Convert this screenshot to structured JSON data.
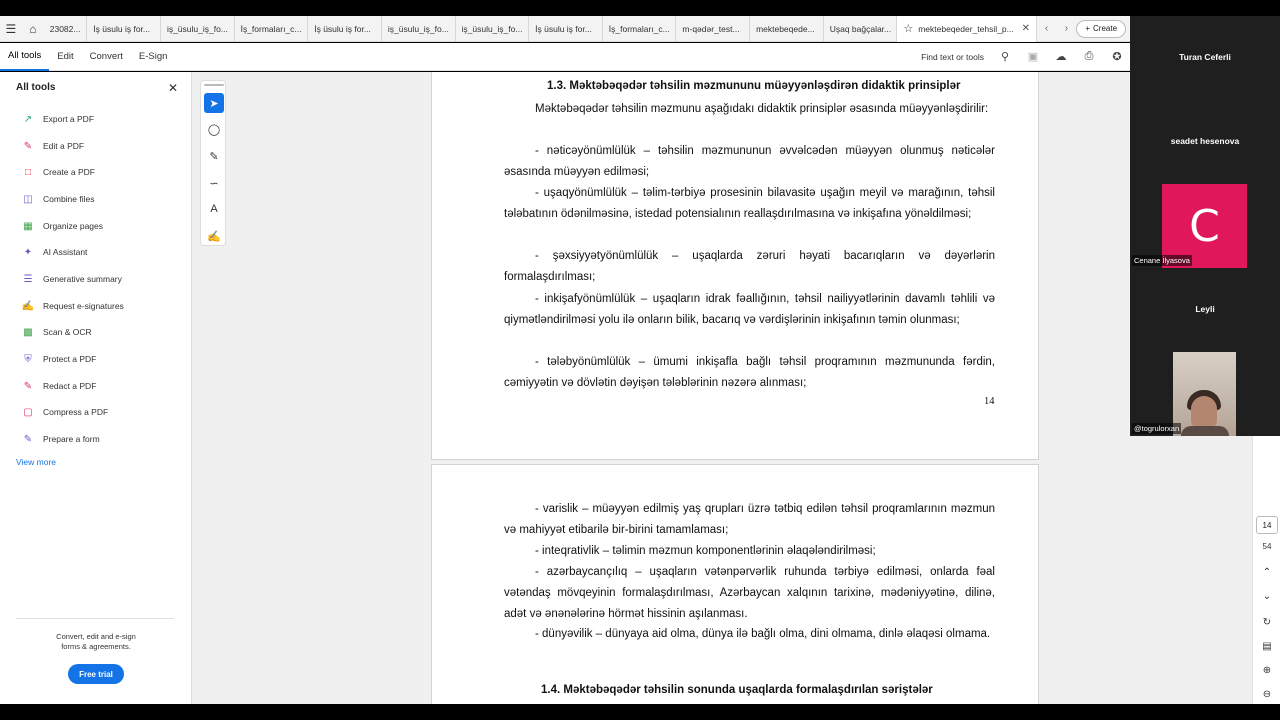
{
  "browser": {
    "tabs": [
      {
        "label": "23082..."
      },
      {
        "label": "İş üsulu iş for..."
      },
      {
        "label": "iş_üsulu_iş_fo..."
      },
      {
        "label": "İş_formaları_c..."
      },
      {
        "label": "İş üsulu iş for..."
      },
      {
        "label": "iş_üsulu_iş_fo..."
      },
      {
        "label": "iş_üsulu_iş_fo..."
      },
      {
        "label": "İş üsulu iş for..."
      },
      {
        "label": "İş_formaları_c..."
      },
      {
        "label": "m-qədər_test..."
      },
      {
        "label": "mektebeqede..."
      },
      {
        "label": "Uşaq bağçalar..."
      }
    ],
    "active_tab": {
      "label": "mektebeqeder_tehsil_p..."
    },
    "create_label": "Create"
  },
  "toolbar": {
    "menus": [
      "All tools",
      "Edit",
      "Convert",
      "E-Sign"
    ],
    "find_text": "Find text or tools"
  },
  "left_panel": {
    "title": "All tools",
    "items": [
      {
        "label": "Export a PDF",
        "icon": "export-pdf-icon",
        "color": "#26a269"
      },
      {
        "label": "Edit a PDF",
        "icon": "edit-pdf-icon",
        "color": "#d8345f"
      },
      {
        "label": "Create a PDF",
        "icon": "create-pdf-icon",
        "color": "#e0344a"
      },
      {
        "label": "Combine files",
        "icon": "combine-files-icon",
        "color": "#6f5ac7"
      },
      {
        "label": "Organize pages",
        "icon": "organize-pages-icon",
        "color": "#3a9f45"
      },
      {
        "label": "AI Assistant",
        "icon": "ai-assistant-icon",
        "color": "#6f5ac7"
      },
      {
        "label": "Generative summary",
        "icon": "generative-summary-icon",
        "color": "#6f5ac7"
      },
      {
        "label": "Request e-signatures",
        "icon": "request-esign-icon",
        "color": "#6f5ac7"
      },
      {
        "label": "Scan & OCR",
        "icon": "scan-ocr-icon",
        "color": "#3a9f45"
      },
      {
        "label": "Protect a PDF",
        "icon": "protect-pdf-icon",
        "color": "#6f5ac7"
      },
      {
        "label": "Redact a PDF",
        "icon": "redact-pdf-icon",
        "color": "#d8345f"
      },
      {
        "label": "Compress a PDF",
        "icon": "compress-pdf-icon",
        "color": "#d8345f"
      },
      {
        "label": "Prepare a form",
        "icon": "prepare-form-icon",
        "color": "#6f5ac7"
      }
    ],
    "view_more": "View more",
    "promo_line1": "Convert, edit and e-sign",
    "promo_line2": "forms & agreements.",
    "trial_button": "Free trial"
  },
  "document": {
    "page1": {
      "heading": "1.3. Məktəbəqədər təhsilin məzmununu müəyyənləşdirən didaktik prinsiplər",
      "paragraph_intro": "Məktəbəqədər təhsilin məzmunu aşağıdakı didaktik prinsiplər əsasında müəyyənləşdirilir:",
      "item1": "- nəticəyönümlülük – təhsilin məzmununun əvvəlcədən müəyyən olunmuş nəticələr əsasında müəyyən edilməsi;",
      "item2": "- uşaqyönümlülük – təlim-tərbiyə prosesinin bilavasitə uşağın meyil və marağının, təhsil tələbatının ödənilməsinə, istedad potensialının reallaşdırılmasına və inkişafına yönəldilməsi;",
      "item3": "- şəxsiyyətyönümlülük – uşaqlarda zəruri həyati bacarıqların və dəyərlərin formalaşdırılması;",
      "item4": "- inkişafyönümlülük – uşaqların idrak fəallığının, təhsil nailiyyətlərinin davamlı təhlili və qiymətləndirilməsi yolu ilə onların bilik, bacarıq və vərdişlərinin inkişafının təmin olunması;",
      "item5": "- tələbyönümlülük – ümumi inkişafla bağlı təhsil proqramının məzmununda fərdin, cəmiyyətin və dövlətin dəyişən tələblərinin nəzərə alınması;",
      "page_number": "14"
    },
    "page2": {
      "item6": "- varislik – müəyyən edilmiş yaş qrupları üzrə tətbiq edilən təhsil proqramlarının məzmun və mahiyyət etibarilə bir-birini tamamlaması;",
      "item7": "- inteqrativlik – təlimin məzmun komponentlərinin əlaqələndirilməsi;",
      "item8": "- azərbaycançılıq – uşaqların vətənpərvərlik ruhunda tərbiyə edilməsi, onlarda fəal vətəndaş mövqeyinin formalaşdırılması, Azərbaycan xalqının tarixinə, mədəniyyətinə, dilinə, adət və ənənələrinə hörmət hissinin aşılanması.",
      "item9": "- dünyəvilik – dünyaya aid olma, dünya ilə bağlı olma, dini olmama, dinlə əlaqəsi olmama.",
      "heading": "1.4. Məktəbəqədər təhsilin sonunda uşaqlarda formalaşdırılan səriştələr"
    }
  },
  "right_rail": {
    "current_page": "14",
    "total_pages": "54"
  },
  "call": {
    "participant1": "Turan Ceferli",
    "participant2": "seadet hesenova",
    "avatar_letter": "C",
    "avatar_label": "Cenane İlyasova",
    "avatar_color": "#e0185b",
    "participant4": "Leyli",
    "video_label": "@togrulorxan"
  }
}
